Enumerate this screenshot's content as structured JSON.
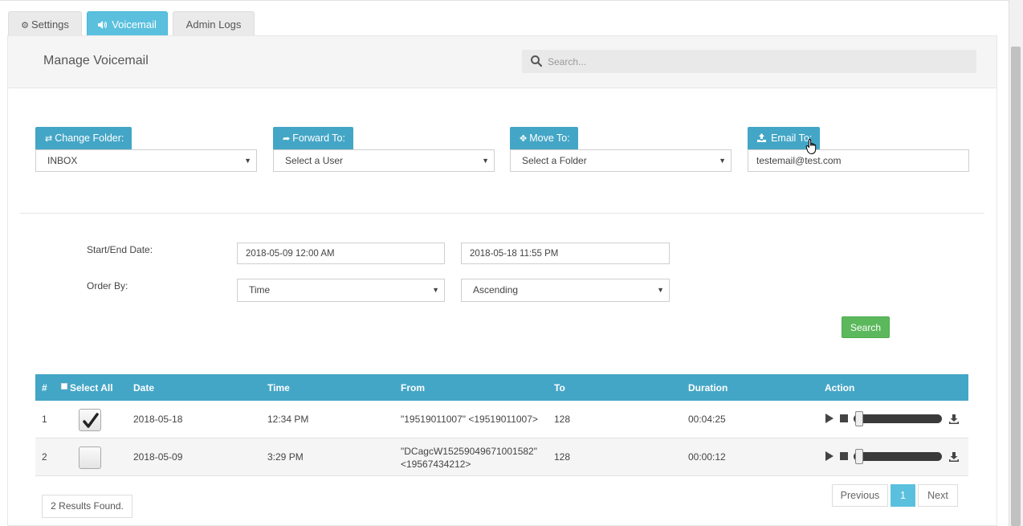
{
  "tabs": [
    {
      "label": "Settings",
      "icon": "gear-icon",
      "active": false
    },
    {
      "label": "Voicemail",
      "icon": "volume-icon",
      "active": true
    },
    {
      "label": "Admin Logs",
      "icon": "",
      "active": false
    }
  ],
  "header": {
    "title": "Manage Voicemail",
    "search_placeholder": "Search..."
  },
  "actions": {
    "change_folder": {
      "label": "Change Folder:",
      "icon": "exchange-icon",
      "value": "INBOX"
    },
    "forward_to": {
      "label": "Forward To:",
      "icon": "share-icon",
      "value": "Select a User"
    },
    "move_to": {
      "label": "Move To:",
      "icon": "move-icon",
      "value": "Select a Folder"
    },
    "email_to": {
      "label": "Email To:",
      "icon": "upload-icon",
      "value": "testemail@test.com"
    }
  },
  "filters": {
    "date_label": "Start/End Date:",
    "start_date": "2018-05-09 12:00 AM",
    "end_date": "2018-05-18 11:55 PM",
    "order_label": "Order By:",
    "order_by": "Time",
    "order_dir": "Ascending",
    "search_button": "Search"
  },
  "table": {
    "columns": [
      "#",
      "Select All",
      "Date",
      "Time",
      "From",
      "To",
      "Duration",
      "Action"
    ],
    "rows": [
      {
        "num": "1",
        "checked": true,
        "date": "2018-05-18",
        "time": "12:34 PM",
        "from_line1": "\"19519011007\" <19519011007>",
        "from_line2": "",
        "to": "128",
        "duration": "00:04:25"
      },
      {
        "num": "2",
        "checked": false,
        "date": "2018-05-09",
        "time": "3:29 PM",
        "from_line1": "\"DCagcW15259049671001582\"",
        "from_line2": "<19567434212>",
        "to": "128",
        "duration": "00:00:12"
      }
    ]
  },
  "footer": {
    "results_text": "2 Results Found.",
    "prev_label": "Previous",
    "current_page": "1",
    "next_label": "Next"
  },
  "colors": {
    "accent": "#44a6c6",
    "tab_active": "#5bc0de",
    "success": "#5cb85c"
  }
}
